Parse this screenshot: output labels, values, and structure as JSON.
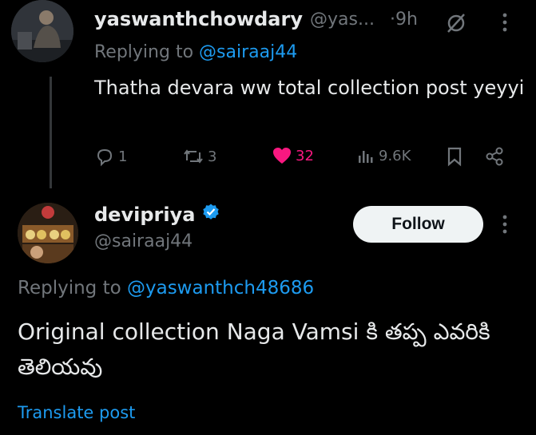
{
  "tweet1": {
    "display_name": "yaswanthchowdary",
    "handle": "@yas...",
    "time": "·9h",
    "replying_prefix": "Replying to ",
    "replying_handle": "@sairaaj44",
    "text": "Thatha devara ww total collection post yeyyi",
    "actions": {
      "replies": "1",
      "reposts": "3",
      "likes": "32",
      "views": "9.6K"
    },
    "colors": {
      "like_active": "#f91880"
    }
  },
  "tweet2": {
    "display_name": "devipriya",
    "handle": "@sairaaj44",
    "follow_label": "Follow",
    "replying_prefix": "Replying to ",
    "replying_handle": "@yaswanthch48686",
    "text": "Original collection Naga Vamsi కి తప్ప ఎవరికి తెలియవు",
    "translate_label": "Translate post"
  },
  "colors": {
    "background": "#000000",
    "text_primary": "#e7e9ea",
    "text_secondary": "#71767b",
    "link": "#1d9bf0",
    "verified": "#1d9bf0"
  },
  "icons": [
    "reply-icon",
    "repost-icon",
    "heart-icon",
    "views-icon",
    "bookmark-icon",
    "share-icon",
    "verified-icon",
    "more-icon",
    "muted-icon"
  ]
}
